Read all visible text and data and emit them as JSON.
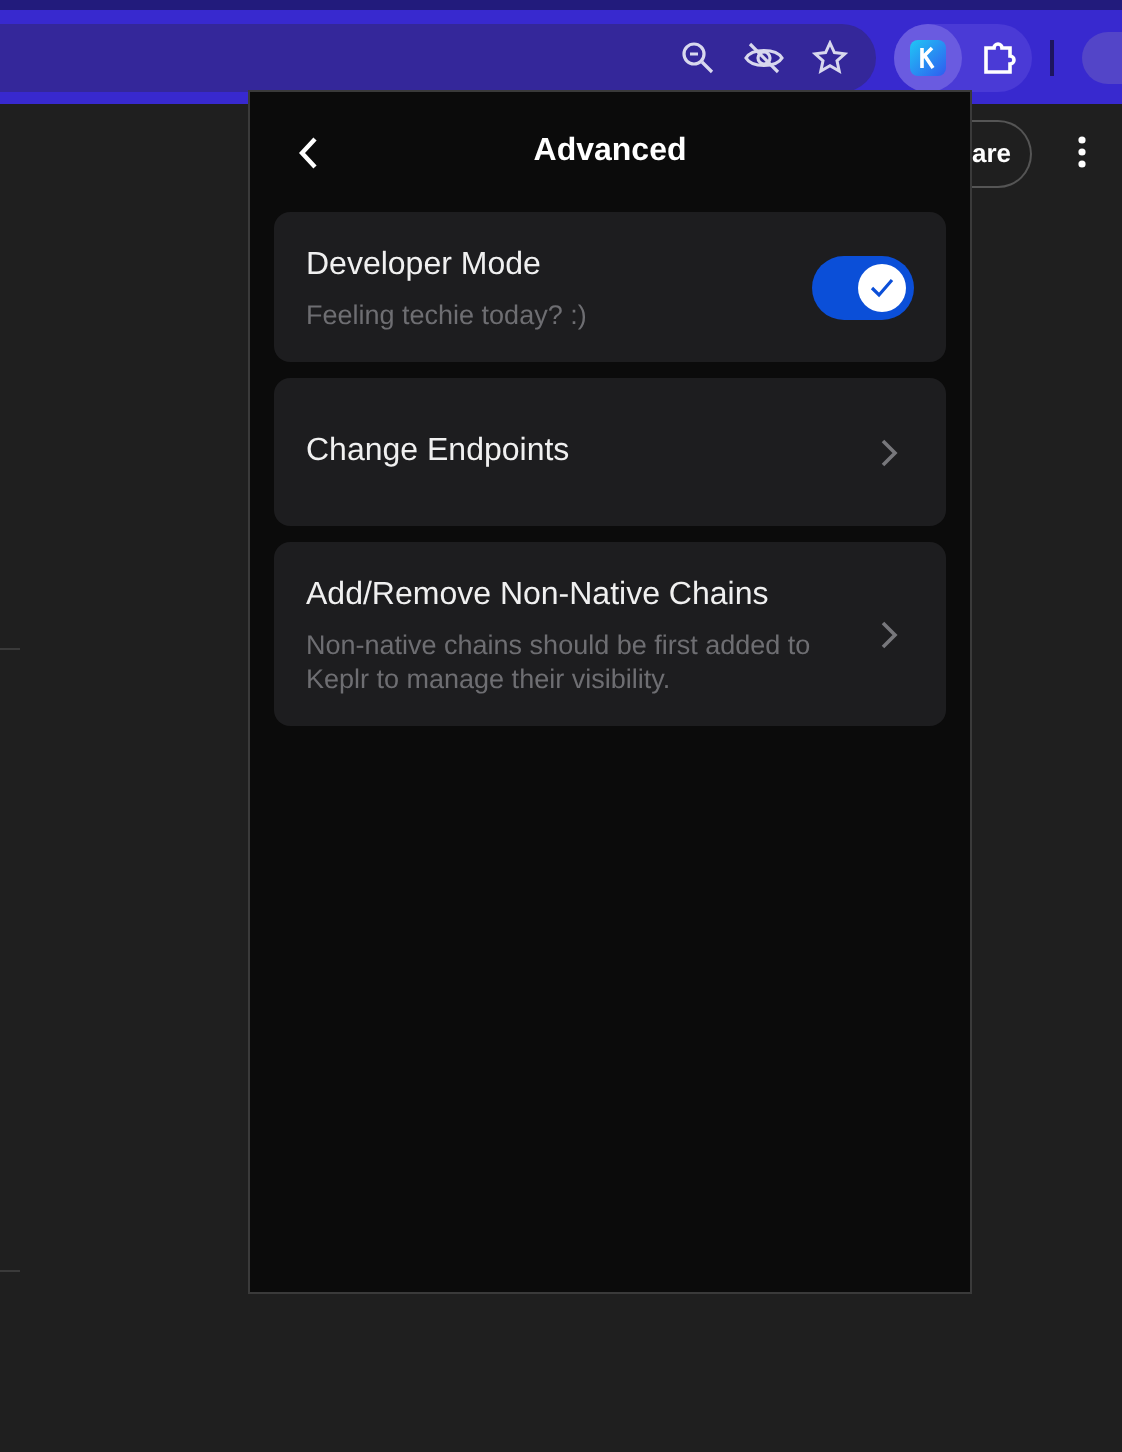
{
  "browser": {
    "extension_active": true
  },
  "page": {
    "share_button": "are"
  },
  "popup": {
    "title": "Advanced",
    "items": [
      {
        "kind": "toggle",
        "title": "Developer Mode",
        "subtitle": "Feeling techie today? :)",
        "on": true
      },
      {
        "kind": "link",
        "title": "Change Endpoints"
      },
      {
        "kind": "link",
        "title": "Add/Remove Non-Native Chains",
        "subtitle": "Non-native chains should be first added to Keplr to manage their visibility."
      }
    ]
  }
}
